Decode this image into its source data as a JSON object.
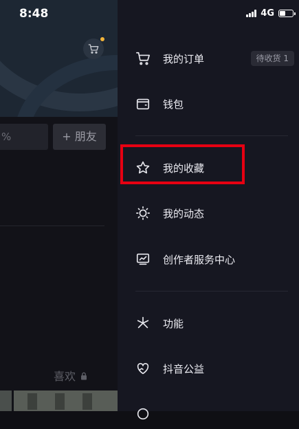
{
  "status_bar": {
    "time": "8:48",
    "network": "4G",
    "battery_level": 0.45
  },
  "profile_background": {
    "percent_text": "%",
    "add_friend_label": "+ 朋友",
    "likes_tab_label": "喜欢"
  },
  "drawer": {
    "menu_items": [
      {
        "label": "我的订单",
        "icon": "cart-icon",
        "badge": "待收货 1"
      },
      {
        "label": "钱包",
        "icon": "wallet-icon"
      },
      {
        "label": "我的收藏",
        "icon": "star-icon"
      },
      {
        "label": "我的动态",
        "icon": "sun-icon"
      },
      {
        "label": "创作者服务中心",
        "icon": "chart-monitor-icon"
      },
      {
        "label": "功能",
        "icon": "asterisk-icon"
      },
      {
        "label": "抖音公益",
        "icon": "heart-hands-icon"
      }
    ]
  },
  "highlight_color": "#e60012"
}
